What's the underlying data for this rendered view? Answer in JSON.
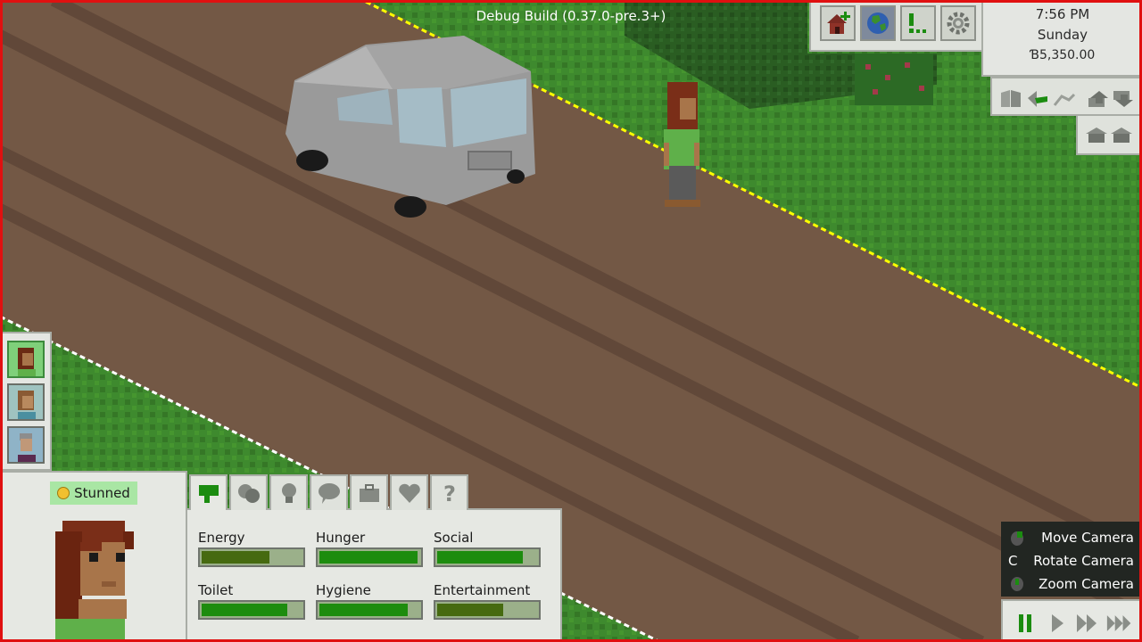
{
  "debug_label": "Debug Build (0.37.0-pre.3+)",
  "toolbar": {
    "build_icon": "house-add-icon",
    "world_icon": "globe-icon",
    "events_icon": "alert-list-icon",
    "settings_icon": "gear-icon",
    "active": "world"
  },
  "clock": {
    "time": "7:56 PM",
    "day": "Sunday",
    "money": "Ɓ5,350.00"
  },
  "camera_tools": {
    "row1": [
      "walls-icon",
      "hand-icon",
      "path-icon",
      "floor-up-icon",
      "floor-down-icon"
    ],
    "row2": [
      "roof-down-icon",
      "roof-up-icon"
    ]
  },
  "household": {
    "members": [
      "sim-portrait-1",
      "sim-portrait-2",
      "sim-portrait-3"
    ],
    "selected_index": 0
  },
  "sim": {
    "mood": "Stunned"
  },
  "tabs": [
    "needs-tab",
    "mood-tab",
    "skills-tab",
    "relationships-tab",
    "career-tab",
    "traits-tab",
    "help-tab"
  ],
  "needs": [
    {
      "label": "Energy",
      "value": 0.68
    },
    {
      "label": "Hunger",
      "value": 0.98
    },
    {
      "label": "Social",
      "value": 0.86
    },
    {
      "label": "Toilet",
      "value": 0.86
    },
    {
      "label": "Hygiene",
      "value": 0.88
    },
    {
      "label": "Entertainment",
      "value": 0.66
    }
  ],
  "hints": {
    "move": {
      "key": "",
      "label": "Move Camera"
    },
    "rotate": {
      "key": "C",
      "label": "Rotate Camera"
    },
    "zoom": {
      "key": "",
      "label": "Zoom Camera"
    }
  },
  "speed_controls": [
    "pause-icon",
    "play-icon",
    "fast-icon",
    "faster-icon"
  ],
  "colors": {
    "grass": "#3b7f2a",
    "road": "#725744",
    "need_fill": "#1d8c0e",
    "frame": "#e01010"
  }
}
